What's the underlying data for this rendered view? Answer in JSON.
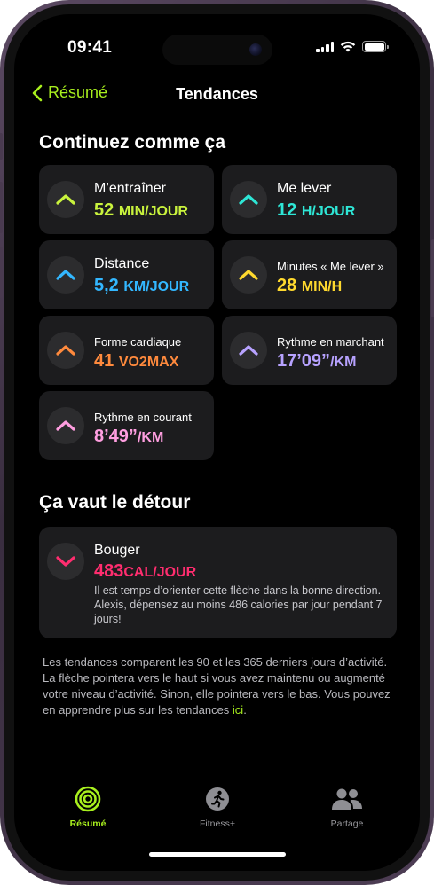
{
  "status": {
    "time": "09:41"
  },
  "nav": {
    "back_label": "Résumé",
    "title": "Tendances"
  },
  "sections": {
    "keep_up": "Continuez comme ça",
    "worth_detour": "Ça vaut le détour"
  },
  "trends": [
    {
      "label": "M’entraîner",
      "value": "52",
      "unit": "MIN/JOUR",
      "color": "#c9f33d",
      "direction": "up"
    },
    {
      "label": "Me lever",
      "value": "12",
      "unit": "H/JOUR",
      "color": "#2ee6d6",
      "direction": "up"
    },
    {
      "label": "Distance",
      "value": "5,2",
      "unit": "KM/JOUR",
      "color": "#33b7ff",
      "direction": "up"
    },
    {
      "label": "Minutes « Me lever »",
      "value": "28",
      "unit": "MIN/H",
      "color": "#ffd92e",
      "direction": "up"
    },
    {
      "label": "Forme cardiaque",
      "value": "41",
      "unit": "VO2MAX",
      "color": "#ff8a3d",
      "direction": "up"
    },
    {
      "label": "Rythme en marchant",
      "value": "17’09”",
      "unit": "/KM",
      "color": "#b7a2ff",
      "direction": "up"
    },
    {
      "label": "Rythme en courant",
      "value": "8’49”",
      "unit": "/KM",
      "color": "#ff9ee0",
      "direction": "up"
    }
  ],
  "detour": {
    "label": "Bouger",
    "value": "483",
    "unit": "CAL/JOUR",
    "color": "#ff2d6f",
    "direction": "down",
    "description": "Il est temps d’orienter cette flèche dans la bonne direction. Alexis, dépensez au moins 486 calories par jour pendant 7 jours!"
  },
  "footer": {
    "text": "Les tendances comparent les 90 et les 365 derniers jours d’activité. La flèche pointera vers le haut si vous avez maintenu ou augmenté votre niveau d’activité. Sinon, elle pointera vers le bas. Vous pouvez en apprendre plus sur les tendances ",
    "link": "ici",
    "end": "."
  },
  "tabs": [
    {
      "label": "Résumé",
      "icon": "activity-rings-icon",
      "active": true
    },
    {
      "label": "Fitness+",
      "icon": "runner-icon",
      "active": false
    },
    {
      "label": "Partage",
      "icon": "people-icon",
      "active": false
    }
  ],
  "colors": {
    "accent": "#a8ef1e"
  }
}
